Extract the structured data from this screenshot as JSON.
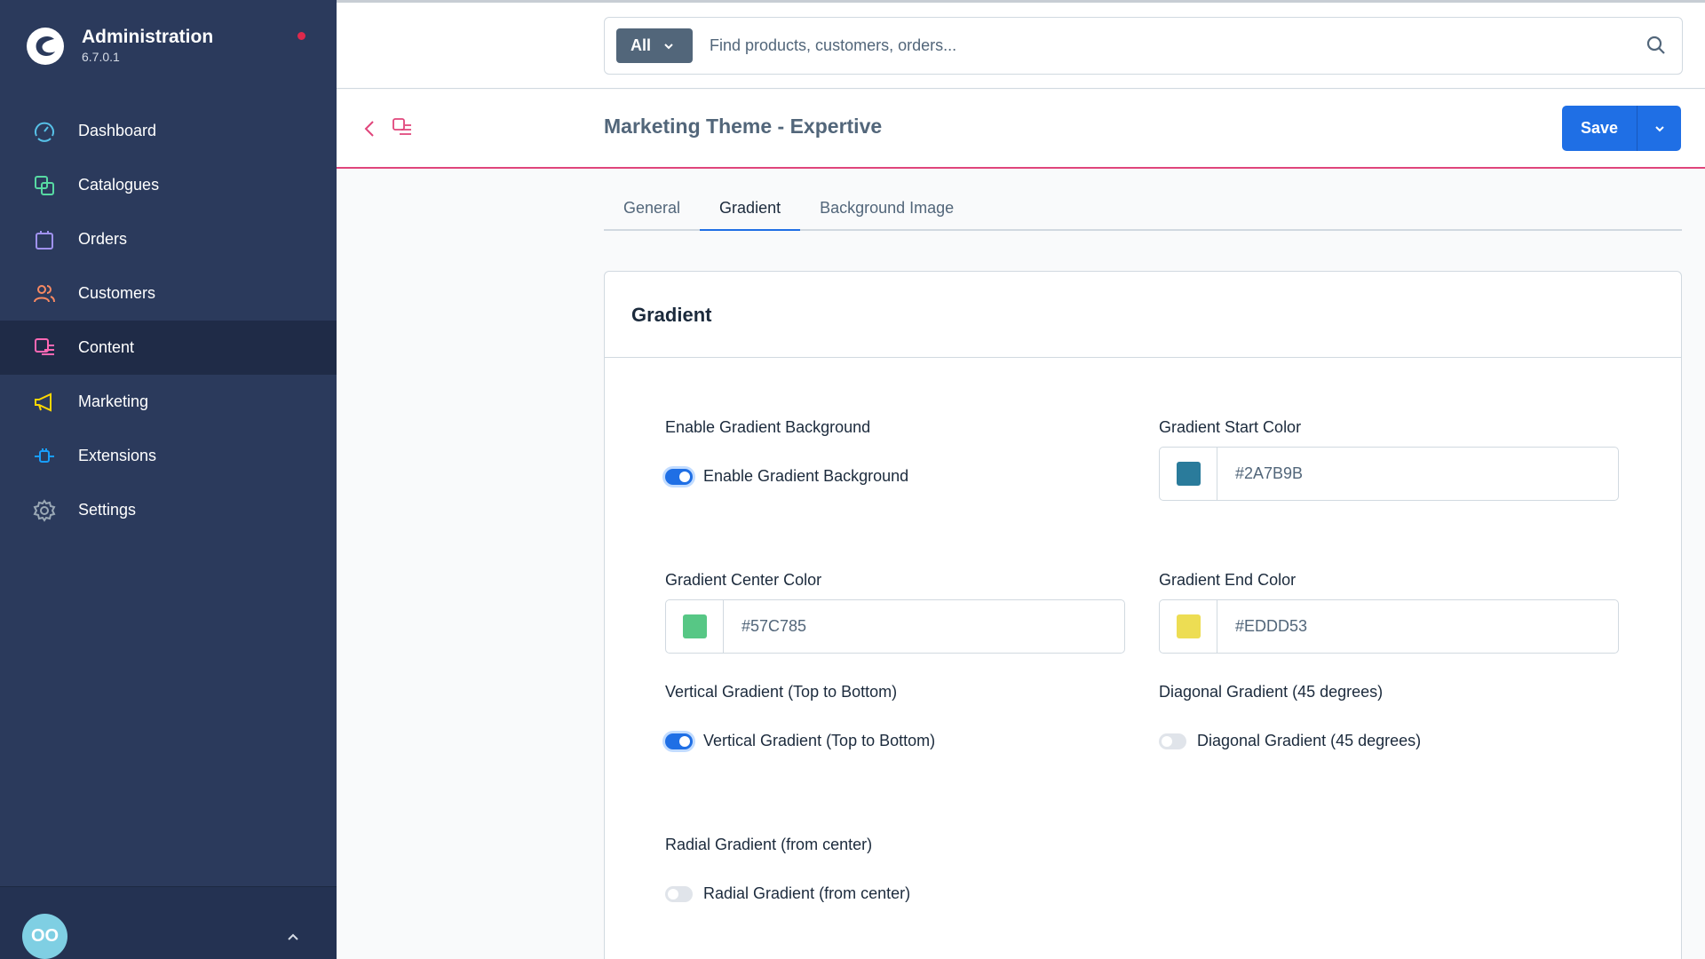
{
  "app": {
    "title": "Administration",
    "version": "6.7.0.1"
  },
  "sidebar": {
    "items": [
      {
        "label": "Dashboard",
        "icon": "dashboard-icon",
        "color": "#57c1e8"
      },
      {
        "label": "Catalogues",
        "icon": "catalogues-icon",
        "color": "#57d9a3"
      },
      {
        "label": "Orders",
        "icon": "orders-icon",
        "color": "#a092f0"
      },
      {
        "label": "Customers",
        "icon": "customers-icon",
        "color": "#f88962"
      },
      {
        "label": "Content",
        "icon": "content-icon",
        "color": "#ff68b4",
        "active": true
      },
      {
        "label": "Marketing",
        "icon": "marketing-icon",
        "color": "#ffd700"
      },
      {
        "label": "Extensions",
        "icon": "extensions-icon",
        "color": "#189eff"
      },
      {
        "label": "Settings",
        "icon": "settings-icon",
        "color": "#9aa8b5"
      }
    ],
    "user_initials": "OO"
  },
  "search": {
    "type_label": "All",
    "placeholder": "Find products, customers, orders..."
  },
  "smartbar": {
    "title": "Marketing Theme - Expertive",
    "save_label": "Save"
  },
  "tabs": [
    {
      "label": "General",
      "active": false
    },
    {
      "label": "Gradient",
      "active": true
    },
    {
      "label": "Background Image",
      "active": false
    }
  ],
  "card": {
    "title": "Gradient",
    "enable_gradient": {
      "label": "Enable Gradient Background",
      "switch_label": "Enable Gradient Background",
      "checked": true
    },
    "start_color": {
      "label": "Gradient Start Color",
      "value": "#2A7B9B",
      "swatch": "#2A7B9B"
    },
    "center_color": {
      "label": "Gradient Center Color",
      "value": "#57C785",
      "swatch": "#57C785"
    },
    "end_color": {
      "label": "Gradient End Color",
      "value": "#EDDD53",
      "swatch": "#EDDD53"
    },
    "vertical": {
      "label": "Vertical Gradient (Top to Bottom)",
      "switch_label": "Vertical Gradient (Top to Bottom)",
      "checked": true
    },
    "diagonal": {
      "label": "Diagonal Gradient (45 degrees)",
      "switch_label": "Diagonal Gradient (45 degrees)",
      "checked": false
    },
    "radial": {
      "label": "Radial Gradient (from center)",
      "switch_label": "Radial Gradient (from center)",
      "checked": false
    }
  }
}
